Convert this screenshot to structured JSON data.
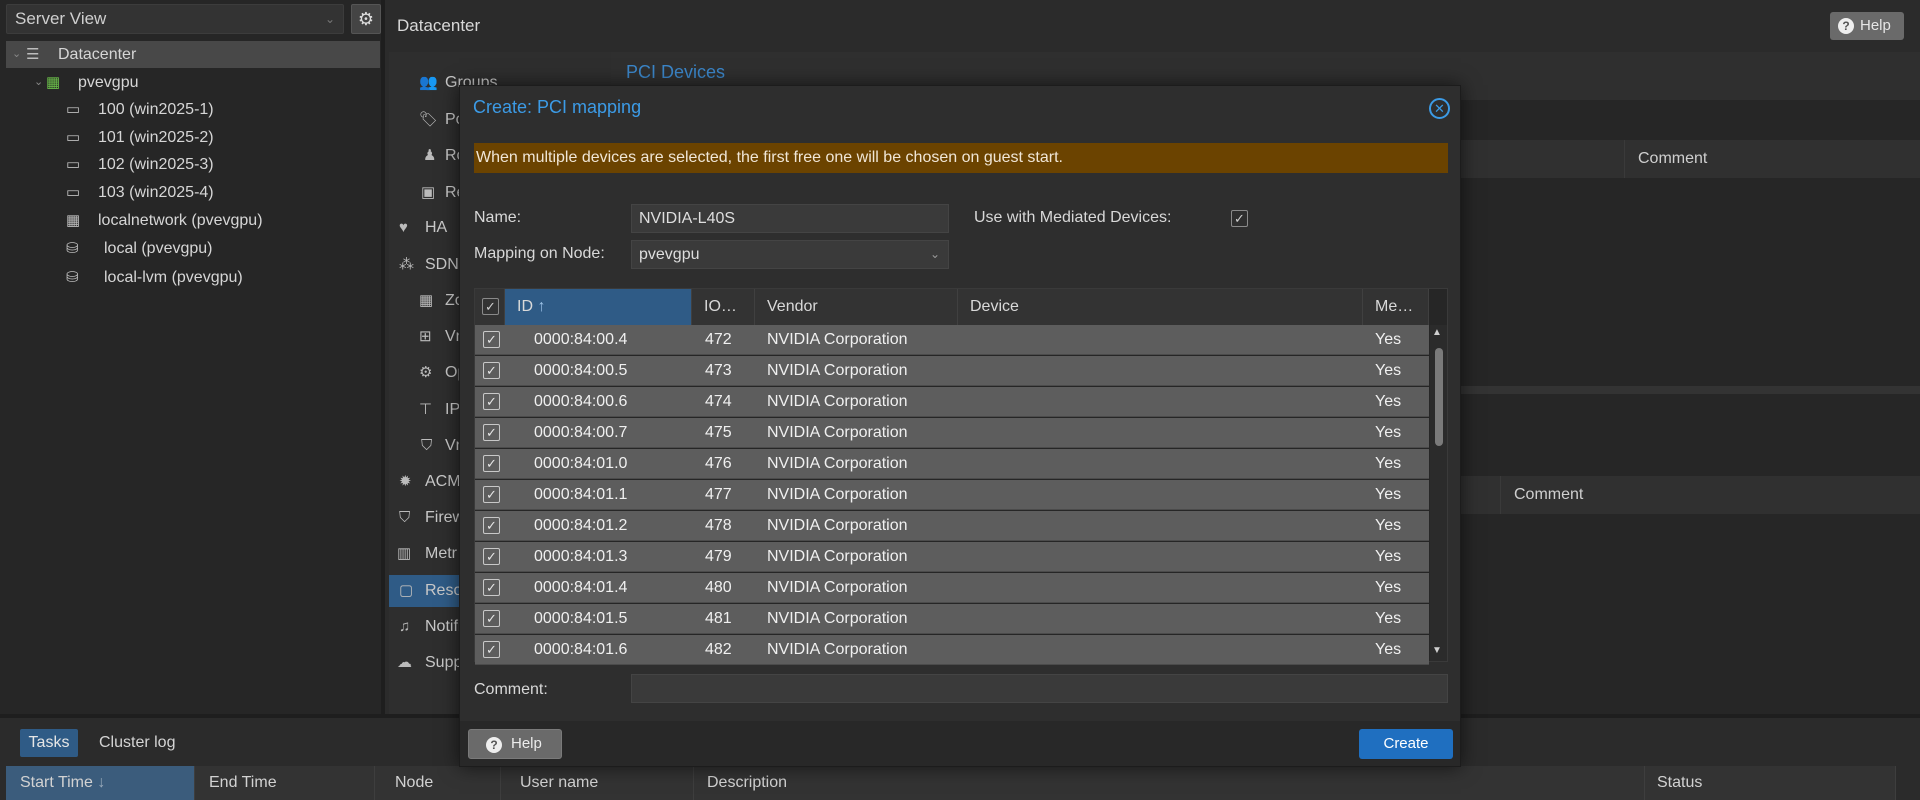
{
  "tree": {
    "view_select": "Server View",
    "items": [
      {
        "label": "Datacenter",
        "type": "datacenter"
      },
      {
        "label": "pvevgpu",
        "type": "node"
      },
      {
        "label": "100 (win2025-1)",
        "type": "vm"
      },
      {
        "label": "101 (win2025-2)",
        "type": "vm"
      },
      {
        "label": "102 (win2025-3)",
        "type": "vm"
      },
      {
        "label": "103 (win2025-4)",
        "type": "vm"
      },
      {
        "label": "localnetwork (pvevgpu)",
        "type": "network"
      },
      {
        "label": "local (pvevgpu)",
        "type": "storage"
      },
      {
        "label": "local-lvm (pvevgpu)",
        "type": "storage"
      }
    ]
  },
  "header": {
    "title": "Datacenter",
    "help_label": "Help"
  },
  "nav": {
    "items": [
      {
        "label": "Groups",
        "icon": "users-icon"
      },
      {
        "label": "Po",
        "icon": "tag-icon"
      },
      {
        "label": "Ro",
        "icon": "person-icon"
      },
      {
        "label": "Re",
        "icon": "id-card-icon"
      },
      {
        "label": "HA",
        "icon": "heartbeat-icon"
      },
      {
        "label": "SDN",
        "icon": "sdn-icon"
      },
      {
        "label": "Zo",
        "icon": "grid-icon"
      },
      {
        "label": "Vn",
        "icon": "network-icon"
      },
      {
        "label": "Op",
        "icon": "gear-icon"
      },
      {
        "label": "IP",
        "icon": "signpost-icon"
      },
      {
        "label": "Vn",
        "icon": "shield-icon"
      },
      {
        "label": "ACM",
        "icon": "acme-icon"
      },
      {
        "label": "Firew",
        "icon": "shield-icon"
      },
      {
        "label": "Metr",
        "icon": "chart-icon"
      },
      {
        "label": "Reso",
        "icon": "folder-icon"
      },
      {
        "label": "Notifi",
        "icon": "bell-icon"
      },
      {
        "label": "Supp",
        "icon": "comments-icon"
      }
    ]
  },
  "background_panel": {
    "title": "PCI Devices",
    "comment_header_1": "Comment",
    "comment_header_2": "Comment"
  },
  "modal": {
    "title": "Create: PCI mapping",
    "warning": "When multiple devices are selected, the first free one will be chosen on guest start.",
    "name_label": "Name:",
    "name_value": "NVIDIA-L40S",
    "mdev_label": "Use with Mediated Devices:",
    "mdev_checked": true,
    "node_label": "Mapping on Node:",
    "node_value": "pvevgpu",
    "grid": {
      "columns": [
        "ID",
        "IO…",
        "Vendor",
        "Device",
        "Me…"
      ],
      "sort_indicator": "↑",
      "rows": [
        {
          "id": "0000:84:00.4",
          "iommu": "472",
          "vendor": "NVIDIA Corporation",
          "device": "",
          "mdev": "Yes"
        },
        {
          "id": "0000:84:00.5",
          "iommu": "473",
          "vendor": "NVIDIA Corporation",
          "device": "",
          "mdev": "Yes"
        },
        {
          "id": "0000:84:00.6",
          "iommu": "474",
          "vendor": "NVIDIA Corporation",
          "device": "",
          "mdev": "Yes"
        },
        {
          "id": "0000:84:00.7",
          "iommu": "475",
          "vendor": "NVIDIA Corporation",
          "device": "",
          "mdev": "Yes"
        },
        {
          "id": "0000:84:01.0",
          "iommu": "476",
          "vendor": "NVIDIA Corporation",
          "device": "",
          "mdev": "Yes"
        },
        {
          "id": "0000:84:01.1",
          "iommu": "477",
          "vendor": "NVIDIA Corporation",
          "device": "",
          "mdev": "Yes"
        },
        {
          "id": "0000:84:01.2",
          "iommu": "478",
          "vendor": "NVIDIA Corporation",
          "device": "",
          "mdev": "Yes"
        },
        {
          "id": "0000:84:01.3",
          "iommu": "479",
          "vendor": "NVIDIA Corporation",
          "device": "",
          "mdev": "Yes"
        },
        {
          "id": "0000:84:01.4",
          "iommu": "480",
          "vendor": "NVIDIA Corporation",
          "device": "",
          "mdev": "Yes"
        },
        {
          "id": "0000:84:01.5",
          "iommu": "481",
          "vendor": "NVIDIA Corporation",
          "device": "",
          "mdev": "Yes"
        },
        {
          "id": "0000:84:01.6",
          "iommu": "482",
          "vendor": "NVIDIA Corporation",
          "device": "",
          "mdev": "Yes"
        }
      ]
    },
    "comment_label": "Comment:",
    "comment_value": "",
    "help_label": "Help",
    "create_label": "Create"
  },
  "bottom": {
    "tabs": [
      "Tasks",
      "Cluster log"
    ],
    "columns": [
      "Start Time",
      "End Time",
      "Node",
      "User name",
      "Description",
      "Status"
    ],
    "sort_indicator": "↓"
  },
  "colors": {
    "accent": "#3c9be6",
    "selected_blue": "#2f5b86",
    "warning_bg": "#6b4300",
    "create_button": "#1f6fc0"
  }
}
